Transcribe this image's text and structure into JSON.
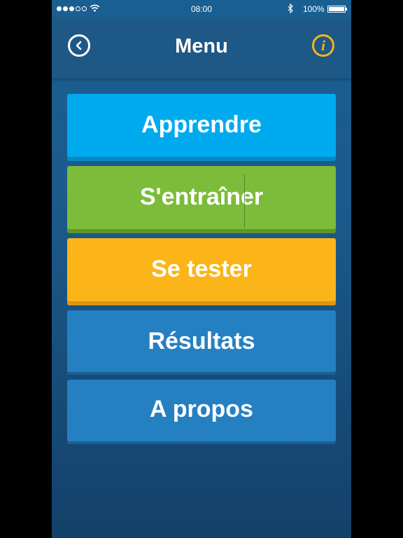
{
  "status_bar": {
    "time": "08:00",
    "battery_pct": "100%",
    "signal_bars_filled": 3,
    "signal_bars_total": 5,
    "icons": [
      "wifi-icon",
      "bluetooth-icon",
      "battery-icon"
    ]
  },
  "nav": {
    "title": "Menu",
    "back_icon": "back-chevron-circle-icon",
    "info_icon": "info-circle-icon",
    "info_label": "i"
  },
  "menu": {
    "items": [
      {
        "label": "Apprendre",
        "color": "#00aaee"
      },
      {
        "label": "S'entraîner",
        "color": "#7cbc3a"
      },
      {
        "label": "Se tester",
        "color": "#fbb518"
      },
      {
        "label": "Résultats",
        "color": "#2580c1"
      },
      {
        "label": "A propos",
        "color": "#2580c1"
      }
    ]
  },
  "colors": {
    "background": "#1c5b8c",
    "accent_info": "#f5b41e"
  }
}
